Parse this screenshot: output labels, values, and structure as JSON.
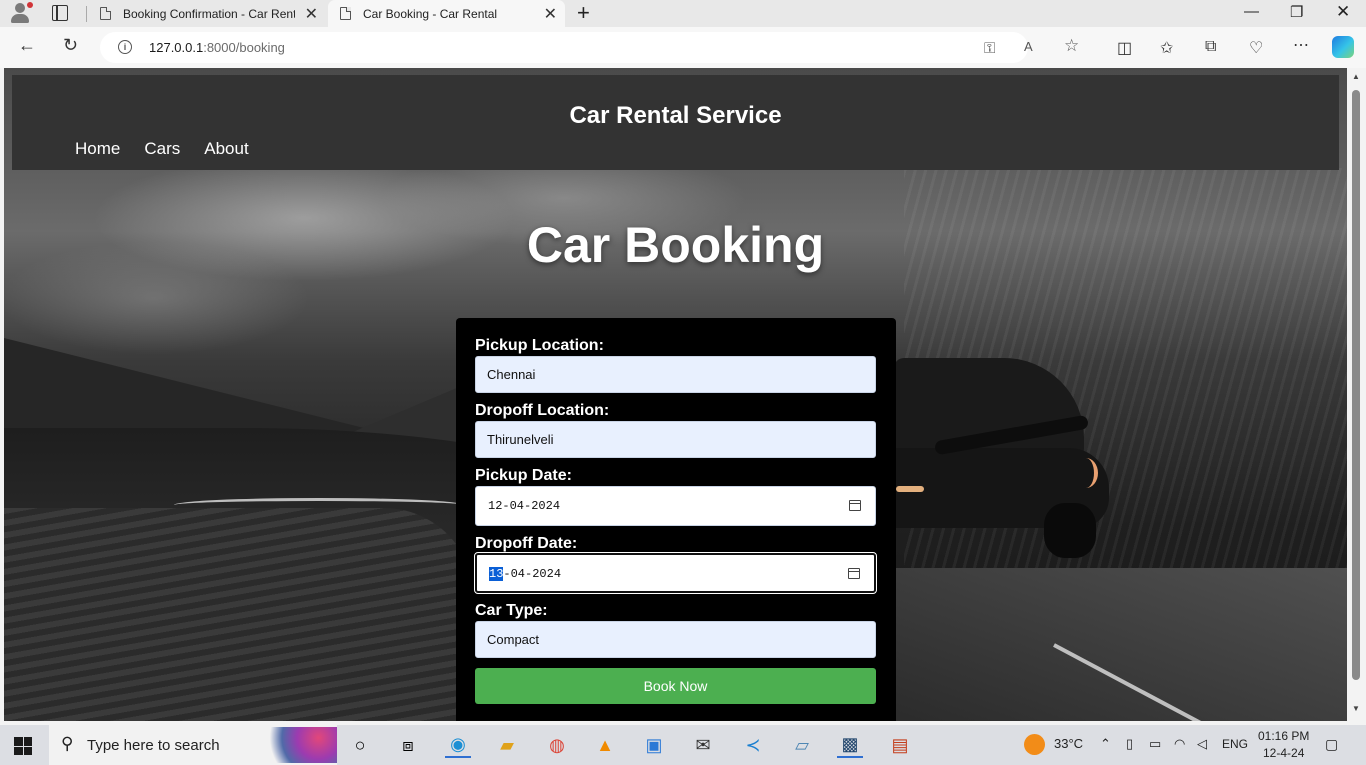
{
  "browser": {
    "tabs": [
      {
        "title": "Booking Confirmation - Car Rental",
        "active": false
      },
      {
        "title": "Car Booking - Car Rental",
        "active": true
      }
    ],
    "url_host": "127.0.0.1",
    "url_rest": ":8000/booking"
  },
  "site": {
    "brand": "Car Rental Service",
    "nav": [
      "Home",
      "Cars",
      "About"
    ]
  },
  "page": {
    "title": "Car Booking"
  },
  "form": {
    "pickup_location": {
      "label": "Pickup Location:",
      "value": "Chennai"
    },
    "dropoff_location": {
      "label": "Dropoff Location:",
      "value": "Thirunelveli"
    },
    "pickup_date": {
      "label": "Pickup Date:",
      "day": "12",
      "rest": "-04-2024"
    },
    "dropoff_date": {
      "label": "Dropoff Date:",
      "day": "13",
      "rest": "-04-2024"
    },
    "car_type": {
      "label": "Car Type:",
      "value": "Compact"
    },
    "submit_label": "Book Now"
  },
  "taskbar": {
    "search_placeholder": "Type here to search",
    "weather": "33°C",
    "language": "ENG",
    "time": "01:16 PM",
    "date": "12-4-24"
  },
  "colors": {
    "header_bg": "#333333",
    "form_bg": "#000000",
    "button_bg": "#4caf50",
    "input_bg": "#e8f0fe"
  }
}
